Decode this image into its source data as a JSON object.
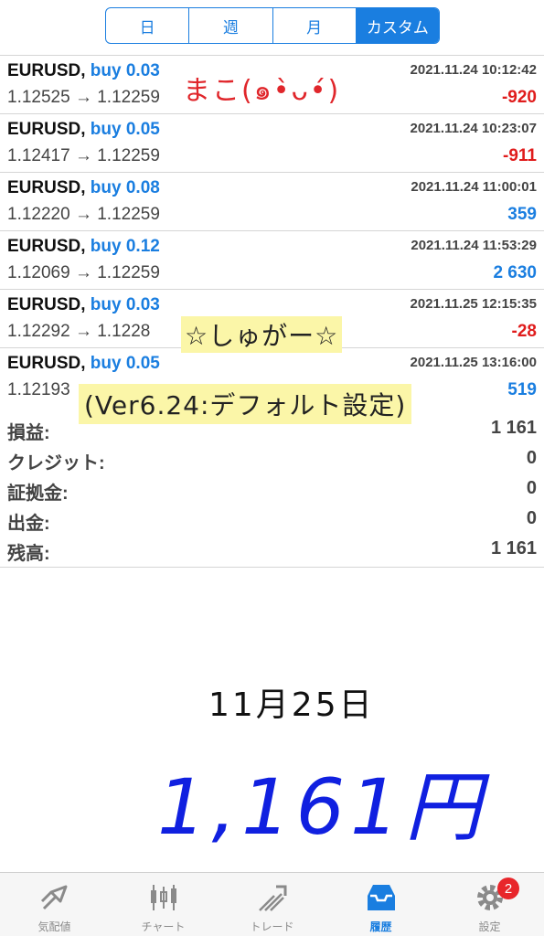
{
  "period_tabs": [
    "日",
    "週",
    "月",
    "カスタム"
  ],
  "active_period": "カスタム",
  "trades": [
    {
      "symbol": "EURUSD,",
      "side": "buy 0.03",
      "time": "2021.11.24 10:12:42",
      "prices": "1.12525 → 1.12259",
      "profit": "-920",
      "sign": "neg"
    },
    {
      "symbol": "EURUSD,",
      "side": "buy 0.05",
      "time": "2021.11.24 10:23:07",
      "prices": "1.12417 → 1.12259",
      "profit": "-911",
      "sign": "neg"
    },
    {
      "symbol": "EURUSD,",
      "side": "buy 0.08",
      "time": "2021.11.24 11:00:01",
      "prices": "1.12220 → 1.12259",
      "profit": "359",
      "sign": "pos"
    },
    {
      "symbol": "EURUSD,",
      "side": "buy 0.12",
      "time": "2021.11.24 11:53:29",
      "prices": "1.12069 → 1.12259",
      "profit": "2 630",
      "sign": "pos"
    },
    {
      "symbol": "EURUSD,",
      "side": "buy 0.03",
      "time": "2021.11.25 12:15:35",
      "prices": "1.12292 → 1.1228",
      "profit": "-28",
      "sign": "neg"
    },
    {
      "symbol": "EURUSD,",
      "side": "buy 0.05",
      "time": "2021.11.25 13:16:00",
      "prices": "1.12193",
      "profit": "519",
      "sign": "pos"
    }
  ],
  "summary": [
    {
      "label": "損益:",
      "value": "1 161"
    },
    {
      "label": "クレジット:",
      "value": "0"
    },
    {
      "label": "証拠金:",
      "value": "0"
    },
    {
      "label": "出金:",
      "value": "0"
    },
    {
      "label": "残高:",
      "value": "1 161"
    }
  ],
  "annotations": {
    "name": "まこ(๑•̀ᴗ•́)",
    "sugar": "☆しゅがー☆",
    "version": "(Ver6.24:デフォルト設定)",
    "date": "11月25日",
    "amount": "1,161円"
  },
  "tabbar": {
    "items": [
      {
        "label": "気配値",
        "icon": "quotes-icon"
      },
      {
        "label": "チャート",
        "icon": "chart-icon"
      },
      {
        "label": "トレード",
        "icon": "trade-icon"
      },
      {
        "label": "履歴",
        "icon": "history-icon"
      },
      {
        "label": "設定",
        "icon": "settings-icon"
      }
    ],
    "active": "履歴",
    "settings_badge": "2"
  },
  "colors": {
    "accent": "#1a7ee0",
    "loss": "#e01c1c",
    "highlight": "#fbf6a8",
    "handwritten_amount": "#1020e0"
  }
}
